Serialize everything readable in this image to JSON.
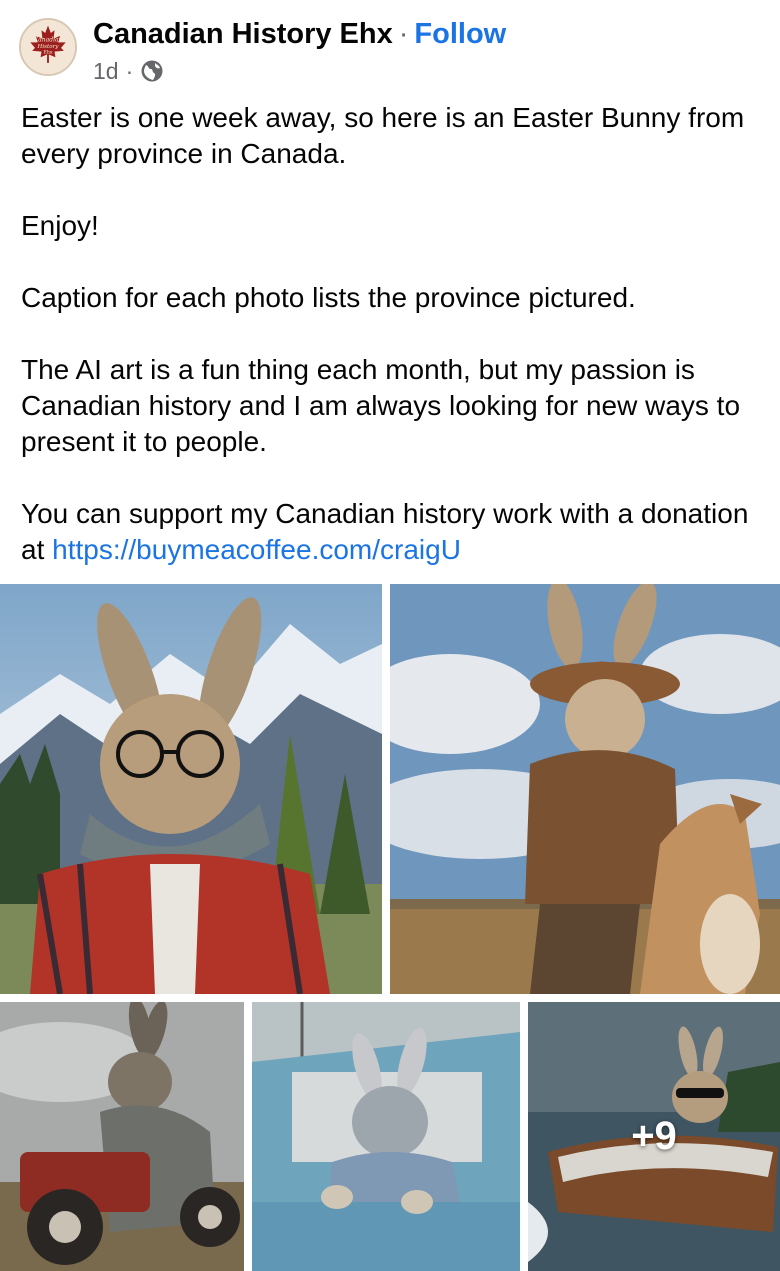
{
  "post": {
    "page_name": "Canadian History Ehx",
    "separator": "·",
    "follow_label": "Follow",
    "time": "1d",
    "audience_icon": "globe-icon",
    "avatar_text": {
      "line1": "Canadian",
      "line2": "History",
      "line3": "Ehx"
    },
    "body": {
      "p1": "Easter is one week away, so here is an Easter Bunny from every province in Canada.",
      "p2": "Enjoy!",
      "p3": "Caption for each photo lists the province pictured.",
      "p4": "The AI art is a fun thing each month, but my passion is Canadian history and I am always looking for new ways to present it to people.",
      "p5_prefix": "You can support my Canadian history work with a donation at ",
      "p5_link": "https://buymeacoffee.com/craigU"
    },
    "photos": [
      {
        "subject": "rabbit with glasses, plaid scarf and red flannel jacket in front of mountains"
      },
      {
        "subject": "rabbit in cowboy hat riding a horse on the prairie"
      },
      {
        "subject": "rabbit driving a red tractor"
      },
      {
        "subject": "rabbit in a blue pickup truck"
      },
      {
        "subject": "rabbit with sunglasses driving a speedboat"
      }
    ],
    "more_photos_label": "+9"
  },
  "colors": {
    "link": "#1b74e4",
    "meta": "#65676b",
    "text": "#050505"
  }
}
